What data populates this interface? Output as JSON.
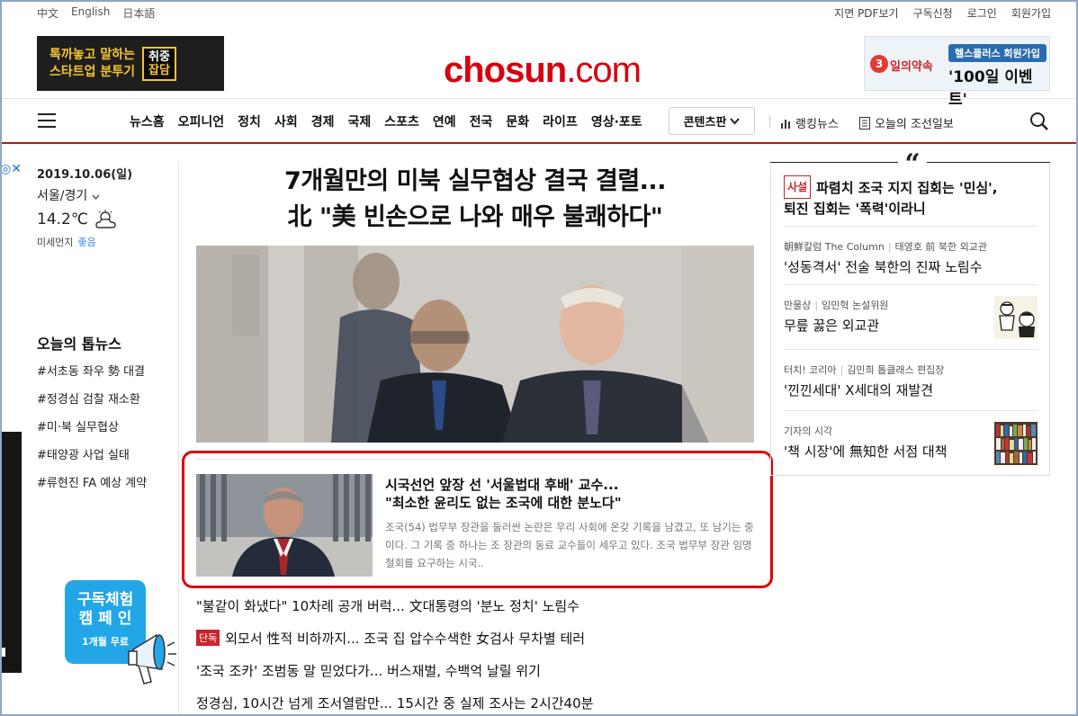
{
  "util": {
    "languages": [
      "中文",
      "English",
      "日本語"
    ],
    "links": [
      "지면 PDF보기",
      "구독신청",
      "로그인",
      "회원가입"
    ]
  },
  "header": {
    "ad_left": {
      "line1": "톡까놓고 말하는",
      "line2": "스타트업 분투기",
      "badge1": "취중",
      "badge2": "잡담"
    },
    "logo": {
      "main": "chosun",
      "suffix": ".com"
    },
    "ad_right": {
      "circle": "3",
      "script": "일의약속",
      "pill": "헬스플러스 회원가입",
      "event": "'100일 이벤트'"
    }
  },
  "nav": {
    "items": [
      "뉴스홈",
      "오피니언",
      "정치",
      "사회",
      "경제",
      "국제",
      "스포츠",
      "연예",
      "전국",
      "문화",
      "라이프",
      "영상·포토"
    ],
    "content_button": "콘텐츠판",
    "ranking": "랭킹뉴스",
    "today_paper": "오늘의 조선일보"
  },
  "weather": {
    "date": "2019.10.06(일)",
    "location": "서울/경기",
    "temp": "14.2℃",
    "dust_label": "미세먼지",
    "dust_value": "좋음"
  },
  "top_news": {
    "title": "오늘의 톱뉴스",
    "items": [
      "#서초동 좌우 勢 대결",
      "#정경심 검찰 재소환",
      "#미·북 실무협상",
      "#태양광 사업 실태",
      "#류현진 FA 예상 계약"
    ]
  },
  "subscribe_ad": {
    "line1": "구독체험",
    "line2": "캠 페 인",
    "line3": "1개월 무료"
  },
  "main": {
    "headline1": "7개월만의 미북 실무협상 결국 결렬...",
    "headline2": "北 \"美 빈손으로 나와 매우 불쾌하다\"",
    "sub_title1": "시국선언 앞장 선 '서울법대 후배' 교수...",
    "sub_title2": "\"최소한 윤리도 없는 조국에 대한 분노다\"",
    "sub_body": "조국(54) 법무부 장관을 둘러싼 논란은 우리 사회에 온갖 기록을 남겼고, 또 남기는 중이다. 그 기록 중 하나는 조 장관의 동료 교수들이 세우고 있다. 조국 법무부 장관 임명 철회를 요구하는 시국..",
    "list": [
      {
        "tag": "",
        "text": "\"불같이 화냈다\" 10차례 공개 버럭... 文대통령의 '분노 정치' 노림수"
      },
      {
        "tag": "단독",
        "text": "외모서 性적 비하까지... 조국 집 압수수색한 女검사 무차별 테러"
      },
      {
        "tag": "",
        "text": "'조국 조카' 조범동 말 믿었다가... 버스재벌, 수백억 날릴 위기"
      },
      {
        "tag": "",
        "text": "정경심, 10시간 넘게 조서열람만... 15시간 중 실제 조사는 2시간40분"
      }
    ]
  },
  "opinion": {
    "editorial_tag": "사설",
    "editorial_title1": "파렴치 조국 지지 집회는 '민심',",
    "editorial_title2": "퇴진 집회는 '폭력'이라니",
    "items": [
      {
        "category": "朝鮮칼럼 The Column",
        "author": "태영호 前 북한 외교관",
        "title": "'성동격서' 전술 북한의 진짜 노림수"
      },
      {
        "category": "만물상",
        "author": "임민혁 논설위원",
        "title": "무릎 꿇은 외교관"
      },
      {
        "category": "터치! 코리아",
        "author": "김민희 톱클래스 편집장",
        "title": "'낀낀세대' X세대의 재발견"
      },
      {
        "category": "기자의 시각",
        "author": "",
        "title": "'책 시장'에 無知한 서점 대책"
      }
    ]
  }
}
